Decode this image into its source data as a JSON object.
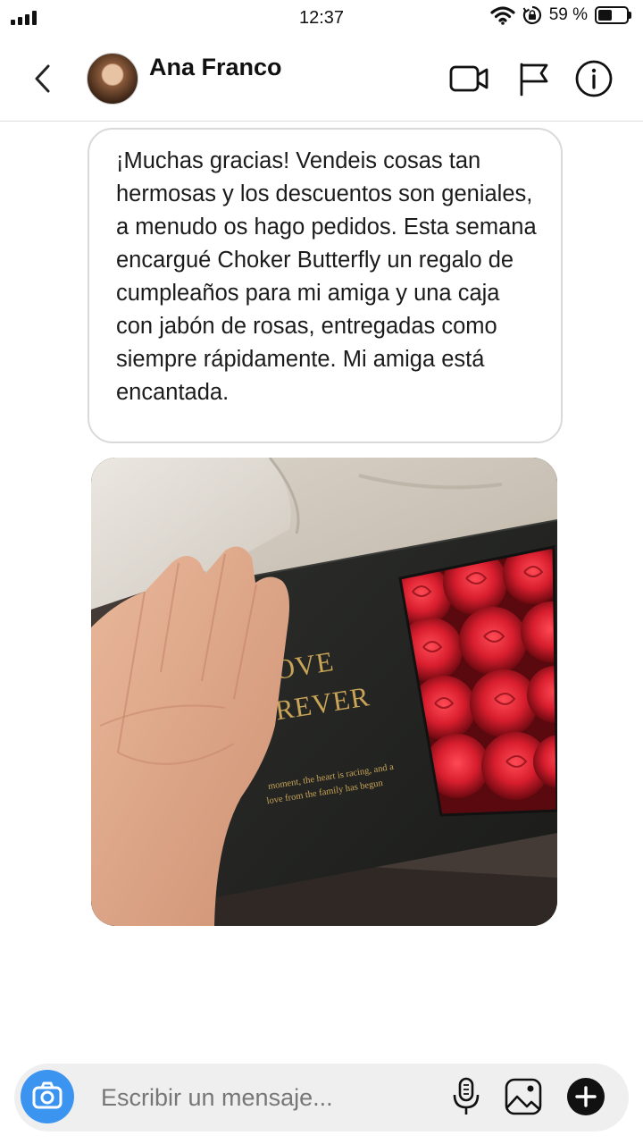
{
  "status_bar": {
    "time": "12:37",
    "battery_text": "59 %",
    "battery_level": 0.59
  },
  "header": {
    "contact_name": "Ana Franco",
    "icons": [
      "chevron-left-icon",
      "video-camera-icon",
      "flag-icon",
      "info-icon"
    ]
  },
  "messages": [
    {
      "type": "text",
      "text": "¡Muchas gracias! Vendeis cosas tan hermosas y los descuentos son geniales, a menudo os hago pedidos. Esta semana encargué Choker Butterfly un regalo de cumpleaños para mi amiga y una caja con jabón de rosas, entregadas como siempre rápidamente. Mi amiga está encantada."
    },
    {
      "type": "photo",
      "box_text_line1": "LOVE",
      "box_text_line2": "OREVER",
      "box_small_line1": "moment, the heart is racing, and a",
      "box_small_line2": "love from the family has begun"
    }
  ],
  "composer": {
    "placeholder": "Escribir un mensaje...",
    "icons": [
      "camera-icon",
      "microphone-icon",
      "image-icon",
      "plus-icon"
    ],
    "accent_color": "#3b95f0"
  }
}
